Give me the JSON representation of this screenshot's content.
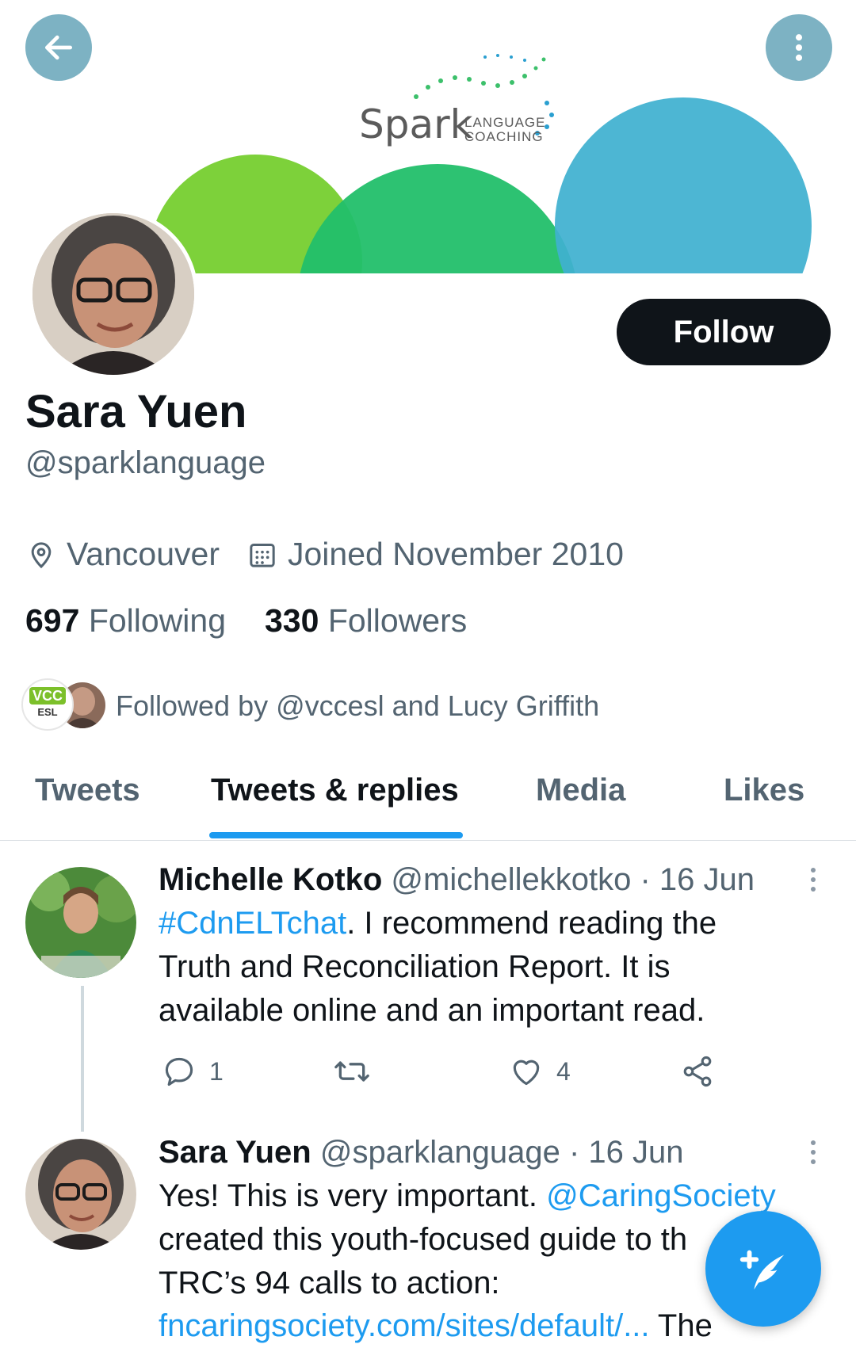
{
  "banner": {
    "logo_main": "Spark",
    "logo_line1": "LANGUAGE",
    "logo_line2": "COACHING"
  },
  "header": {
    "back_icon": "arrow-left-icon",
    "more_icon": "more-vertical-icon"
  },
  "profile": {
    "display_name": "Sara Yuen",
    "handle": "@sparklanguage",
    "location": "Vancouver",
    "joined": "Joined November 2010",
    "following_count": "697",
    "following_label": "Following",
    "followers_count": "330",
    "followers_label": "Followers",
    "followed_by": "Followed by @vccesl and Lucy Griffith",
    "follow_button": "Follow",
    "vcc_badge_top": "VCC",
    "vcc_badge_bottom": "ESL"
  },
  "tabs": [
    {
      "label": "Tweets",
      "active": false
    },
    {
      "label": "Tweets & replies",
      "active": true
    },
    {
      "label": "Media",
      "active": false
    },
    {
      "label": "Likes",
      "active": false
    }
  ],
  "tweets": [
    {
      "name": "Michelle Kotko",
      "handle": "@michellekkotko",
      "date": "· 16 Jun",
      "hashtag": "#CdnELTchat",
      "line1_rest": ". I recommend reading the",
      "line2": "Truth and Reconciliation Report. It is",
      "line3": "available online and an important read.",
      "reply_count": "1",
      "retweet_count": "",
      "like_count": "4"
    },
    {
      "name": "Sara Yuen",
      "handle": "@sparklanguage",
      "date": "· 16 Jun",
      "line1": "Yes! This is very important. ",
      "mention": "@CaringSociety",
      "line2": "created this youth-focused guide to th",
      "line3": "TRC’s 94 calls to action:",
      "link": "fncaringsociety.com/sites/default/...",
      "line4_rest": " The"
    }
  ],
  "colors": {
    "accent": "#1d9bf0",
    "text": "#0f1419",
    "muted": "#536471"
  },
  "compose": {
    "icon": "compose-tweet-icon"
  }
}
